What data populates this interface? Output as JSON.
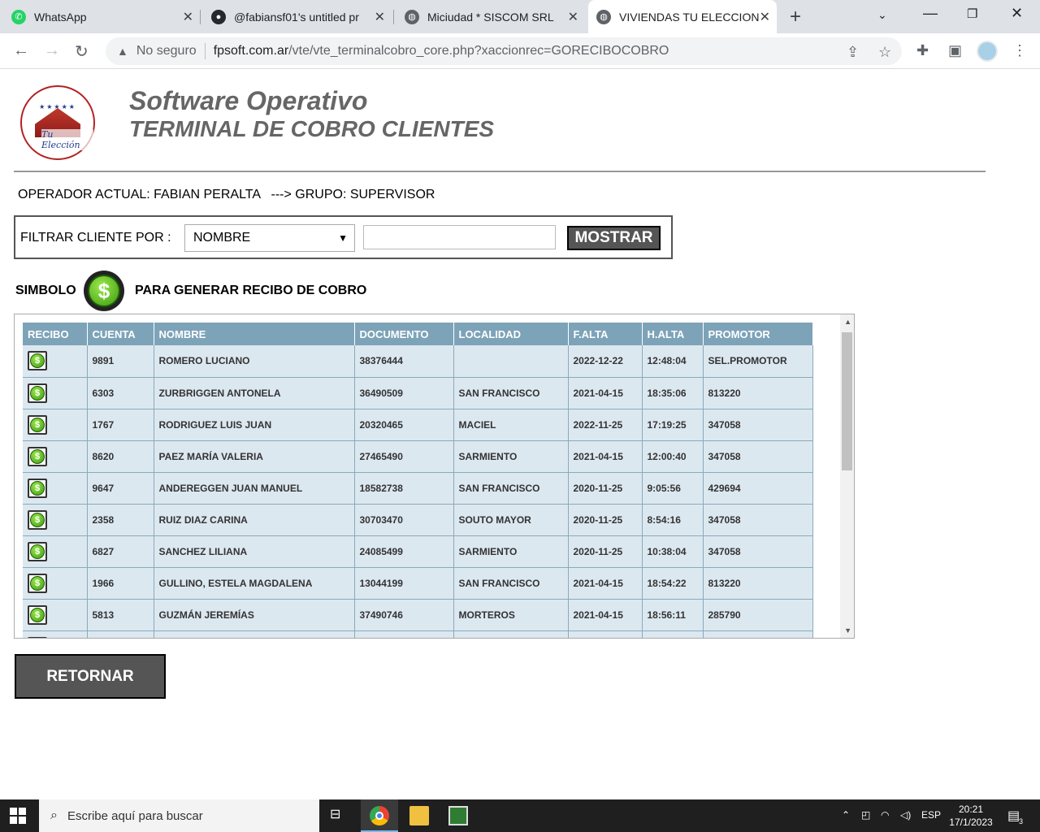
{
  "browser": {
    "tabs": [
      {
        "title": "WhatsApp"
      },
      {
        "title": "@fabiansf01's untitled pr"
      },
      {
        "title": "Miciudad * SISCOM SRL"
      },
      {
        "title": "VIVIENDAS TU ELECCION"
      }
    ],
    "security": "No seguro",
    "url_host": "fpsoft.com.ar",
    "url_path": "/vte/vte_terminalcobro_core.php?xaccionrec=GORECIBOCOBRO"
  },
  "header": {
    "logo_text": "Tu Elección",
    "title1": "Software Operativo",
    "title2": "TERMINAL DE COBRO CLIENTES"
  },
  "operator_line": "OPERADOR ACTUAL: FABIAN PERALTA   ---> GRUPO: SUPERVISOR",
  "filter": {
    "label": "FILTRAR CLIENTE POR :",
    "selected": "NOMBRE",
    "value": "",
    "button": "MOSTRAR"
  },
  "legend": {
    "left": "SIMBOLO",
    "right": "PARA GENERAR RECIBO DE COBRO"
  },
  "table": {
    "headers": [
      "RECIBO",
      "CUENTA",
      "NOMBRE",
      "DOCUMENTO",
      "LOCALIDAD",
      "F.ALTA",
      "H.ALTA",
      "PROMOTOR"
    ],
    "rows": [
      [
        "9891",
        "ROMERO LUCIANO",
        "38376444",
        "",
        "2022-12-22",
        "12:48:04",
        "SEL.PROMOTOR"
      ],
      [
        "6303",
        "ZURBRIGGEN ANTONELA",
        "36490509",
        "SAN FRANCISCO",
        "2021-04-15",
        "18:35:06",
        "813220"
      ],
      [
        "1767",
        "RODRIGUEZ LUIS JUAN",
        "20320465",
        "MACIEL",
        "2022-11-25",
        "17:19:25",
        "347058"
      ],
      [
        "8620",
        "PAEZ MARÍA VALERIA",
        "27465490",
        "SARMIENTO",
        "2021-04-15",
        "12:00:40",
        "347058"
      ],
      [
        "9647",
        "ANDEREGGEN JUAN MANUEL",
        "18582738",
        "SAN FRANCISCO",
        "2020-11-25",
        "9:05:56",
        "429694"
      ],
      [
        "2358",
        "RUIZ DIAZ CARINA",
        "30703470",
        "SOUTO MAYOR",
        "2020-11-25",
        "8:54:16",
        "347058"
      ],
      [
        "6827",
        "SANCHEZ LILIANA",
        "24085499",
        "SARMIENTO",
        "2020-11-25",
        "10:38:04",
        "347058"
      ],
      [
        "1966",
        "GULLINO, ESTELA MAGDALENA",
        "13044199",
        "SAN FRANCISCO",
        "2021-04-15",
        "18:54:22",
        "813220"
      ],
      [
        "5813",
        "GUZMÁN JEREMÍAS",
        "37490746",
        "MORTEROS",
        "2021-04-15",
        "18:56:11",
        "285790"
      ]
    ]
  },
  "retornar": "RETORNAR",
  "taskbar": {
    "search_placeholder": "Escribe aquí para buscar",
    "lang": "ESP",
    "time": "20:21",
    "date": "17/1/2023",
    "notif_count": "3"
  }
}
